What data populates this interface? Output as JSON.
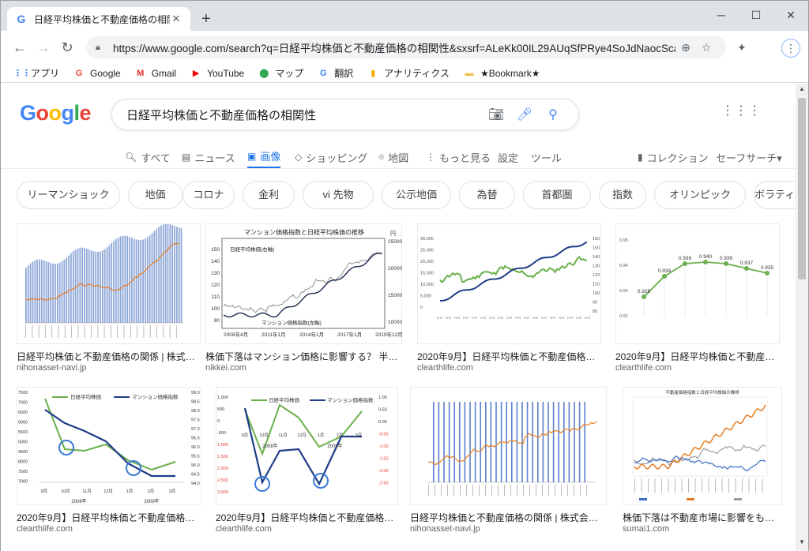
{
  "browser": {
    "tab_title": "日経平均株価と不動産価格の相関",
    "tab_favicon": "G",
    "url": "https://www.google.com/search?q=日経平均株価と不動産価格の相関性&sxsrf=ALeKk00IL29AUqSfPRye4SoJdNaocScaT...",
    "bookmarks": [
      {
        "label": "アプリ",
        "icon": "apps-grid-icon",
        "glyph": "⋮⋮",
        "color": "#4285f4"
      },
      {
        "label": "Google",
        "icon": "google-icon",
        "glyph": "G",
        "color": "#ea4335"
      },
      {
        "label": "Gmail",
        "icon": "gmail-icon",
        "glyph": "M",
        "color": "#d93025"
      },
      {
        "label": "YouTube",
        "icon": "youtube-icon",
        "glyph": "▶",
        "color": "#ff0000"
      },
      {
        "label": "マップ",
        "icon": "maps-pin-icon",
        "glyph": "⬤",
        "color": "#34a853"
      },
      {
        "label": "翻訳",
        "icon": "translate-icon",
        "glyph": "G",
        "color": "#4285f4"
      },
      {
        "label": "アナリティクス",
        "icon": "analytics-icon",
        "glyph": "▮",
        "color": "#f9ab00"
      },
      {
        "label": "★Bookmark★",
        "icon": "folder-icon",
        "glyph": "▬",
        "color": "#f2c046"
      }
    ]
  },
  "google": {
    "logo": "Google",
    "query": "日経平均株価と不動産価格の相関性",
    "nav": [
      {
        "label": "すべて",
        "icon": "search-icon",
        "glyph": "🔍︎",
        "active": false
      },
      {
        "label": "ニュース",
        "icon": "news-icon",
        "glyph": "▤",
        "active": false
      },
      {
        "label": "画像",
        "icon": "image-icon",
        "glyph": "▣",
        "active": true
      },
      {
        "label": "ショッピング",
        "icon": "tag-icon",
        "glyph": "◇",
        "active": false
      },
      {
        "label": "地図",
        "icon": "map-pin-icon",
        "glyph": "⌾",
        "active": false
      },
      {
        "label": "もっと見る",
        "icon": "more-vert-icon",
        "glyph": "⋮",
        "active": false
      },
      {
        "label": "設定",
        "icon": "",
        "glyph": "",
        "active": false
      },
      {
        "label": "ツール",
        "icon": "",
        "glyph": "",
        "active": false
      }
    ],
    "collection": "コレクション",
    "safesearch": "セーフサーチ▾",
    "chips": [
      "リーマンショック",
      "地価",
      "コロナ",
      "金利",
      "vi 先物",
      "公示地価",
      "為替",
      "首都圏",
      "指数",
      "オリンピック",
      "ボラティリティ"
    ],
    "results": [
      {
        "caption": "日経平均株価と不動産価格の関係 | 株式会社...",
        "source": "nihonasset-navi.jp"
      },
      {
        "caption": "株価下落はマンション価格に影響する？ 半年後を...",
        "source": "nikkei.com"
      },
      {
        "caption": "2020年9月】日経平均株価と不動産価格指数の...",
        "source": "clearthlife.com"
      },
      {
        "caption": "2020年9月】日経平均株価と不動産価格...",
        "source": "clearthlife.com"
      },
      {
        "caption": "2020年9月】日経平均株価と不動産価格指数の...",
        "source": "clearthlife.com"
      },
      {
        "caption": "2020年9月】日経平均株価と不動産価格指数...",
        "source": "clearthlife.com"
      },
      {
        "caption": "日経平均株価と不動産価格の関係 | 株式会社日本ア...",
        "source": "nihonasset-navi.jp"
      },
      {
        "caption": "株価下落は不動産市場に影響をもたら...",
        "source": "sumai1.com"
      }
    ],
    "thumb_text": {
      "t2_title": "マンション価格指数と日経平均株価の推移",
      "t2_yen": "円",
      "t2_nikkei": "日経平均株価(右軸)",
      "t2_mansion": "マンション価格指数(左軸)",
      "t2_x": [
        "2008年4月",
        "2011年1月",
        "2014年1月",
        "2017年1月",
        "2019年12月"
      ],
      "t2_yl": [
        "150",
        "140",
        "130",
        "120",
        "110",
        "100",
        "90"
      ],
      "t2_yr": [
        "25000",
        "20000",
        "15000",
        "10000"
      ],
      "t3_yl": [
        "30,000",
        "25,000",
        "20,000",
        "15,000",
        "10,000",
        "5,000",
        "0"
      ],
      "t3_yr": [
        "160",
        "150",
        "140",
        "130",
        "120",
        "110",
        "100",
        "90",
        "80"
      ],
      "t4_yl": [
        "0.95",
        "0.94",
        "0.93",
        "0.92"
      ],
      "t4_vals": [
        "0.928",
        "0.934",
        "0.939",
        "0.940",
        "0.939",
        "0.937",
        "0.935"
      ],
      "t5_yl": [
        "7500",
        "7000",
        "6500",
        "6000",
        "5500",
        "5000",
        "4500",
        "8000",
        "7500",
        "7000"
      ],
      "t5_yr": [
        "99.0",
        "98.5",
        "98.0",
        "97.5",
        "97.0",
        "96.5",
        "96.0",
        "95.5",
        "95.0",
        "94.5",
        "94.0"
      ],
      "t5_legend1": "日経平均株価",
      "t5_legend2": "マンション価格指数",
      "t5_x": [
        "9月",
        "10月",
        "11月",
        "12月",
        "1月",
        "2月",
        "3月"
      ],
      "t5_y1": "2008年",
      "t5_y2": "2009年",
      "t6_legend1": "日経平均株価",
      "t6_legend2": "マンション価格指数",
      "t6_yl": [
        "1,000",
        "500",
        "0",
        "-500",
        "1,000",
        "1,500",
        "2,000",
        "2,500",
        "3,000"
      ],
      "t6_yr": [
        "1.00",
        "0.50",
        "0.00",
        "-0.50",
        "-1.00",
        "-1.50",
        "-2.00",
        "-2.50"
      ],
      "t6_x": [
        "9月",
        "10月",
        "11月",
        "12月",
        "1月",
        "2月",
        "3月"
      ],
      "t6_y1": "2008年",
      "t6_y2": "2009年",
      "t8_title": "不動産価格指数と日経平均株価の推移"
    }
  },
  "colors": {
    "blue": "#1f3c88",
    "green": "#6ab04c",
    "orange": "#e67e22",
    "accent": "#1a73e8"
  }
}
